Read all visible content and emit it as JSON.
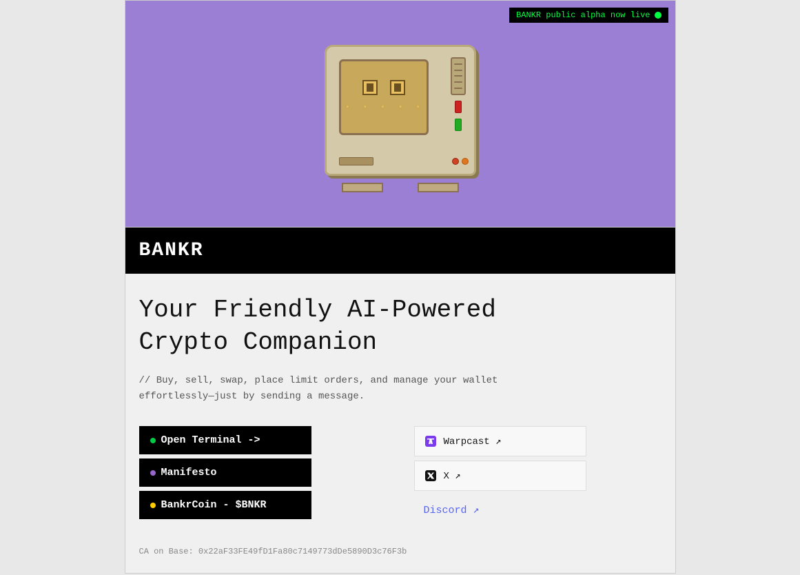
{
  "status": {
    "badge_text": "BANKR public alpha now live",
    "dot_color": "#00ff41"
  },
  "brand": {
    "title": "BANKR"
  },
  "hero": {
    "headline": "Your Friendly AI-Powered\nCrypto Companion",
    "subtext": "// Buy, sell, swap, place limit orders, and manage your wallet\neffortlessly—just by sending a message."
  },
  "buttons": {
    "open_terminal": "Open Terminal ->",
    "manifesto": "Manifesto",
    "bankrcoin": "BankrCoin - $BNKR"
  },
  "social_links": {
    "warpcast": "Warpcast ↗",
    "x": "X ↗",
    "discord": "Discord ↗"
  },
  "footer": {
    "ca_text": "CA on Base: 0x22aF33FE49fD1Fa80c7149773dDe5890D3c76F3b"
  }
}
